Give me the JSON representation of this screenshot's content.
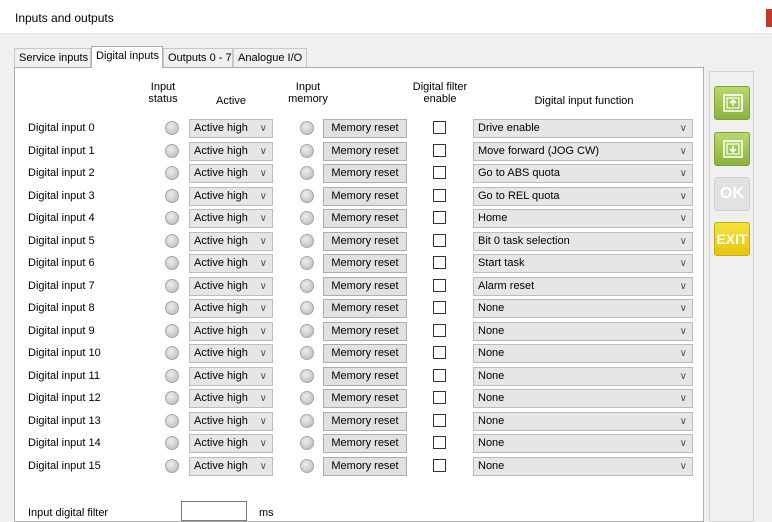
{
  "window": {
    "title": "Inputs and outputs"
  },
  "tabs": [
    {
      "label": "Service inputs",
      "active": false
    },
    {
      "label": "Digital inputs",
      "active": true
    },
    {
      "label": "Outputs 0 - 7",
      "active": false
    },
    {
      "label": "Analogue I/O",
      "active": false
    }
  ],
  "headers": {
    "input_status": "Input\nstatus",
    "active": "Active",
    "input_memory": "Input\nmemory",
    "digital_filter_enable": "Digital filter\nenable",
    "digital_input_function": "Digital input function"
  },
  "rows": [
    {
      "label": "Digital input 0",
      "active": "Active high",
      "memory_reset": "Memory reset",
      "filter_enabled": false,
      "function": "Drive enable"
    },
    {
      "label": "Digital input 1",
      "active": "Active high",
      "memory_reset": "Memory reset",
      "filter_enabled": false,
      "function": "Move forward (JOG CW)"
    },
    {
      "label": "Digital input 2",
      "active": "Active high",
      "memory_reset": "Memory reset",
      "filter_enabled": false,
      "function": "Go to ABS quota"
    },
    {
      "label": "Digital input 3",
      "active": "Active high",
      "memory_reset": "Memory reset",
      "filter_enabled": false,
      "function": "Go to REL quota"
    },
    {
      "label": "Digital input 4",
      "active": "Active high",
      "memory_reset": "Memory reset",
      "filter_enabled": false,
      "function": "Home"
    },
    {
      "label": "Digital input 5",
      "active": "Active high",
      "memory_reset": "Memory reset",
      "filter_enabled": false,
      "function": "Bit 0 task selection"
    },
    {
      "label": "Digital input 6",
      "active": "Active high",
      "memory_reset": "Memory reset",
      "filter_enabled": false,
      "function": "Start task"
    },
    {
      "label": "Digital input 7",
      "active": "Active high",
      "memory_reset": "Memory reset",
      "filter_enabled": false,
      "function": "Alarm reset"
    },
    {
      "label": "Digital input 8",
      "active": "Active high",
      "memory_reset": "Memory reset",
      "filter_enabled": false,
      "function": "None"
    },
    {
      "label": "Digital input 9",
      "active": "Active high",
      "memory_reset": "Memory reset",
      "filter_enabled": false,
      "function": "None"
    },
    {
      "label": "Digital input 10",
      "active": "Active high",
      "memory_reset": "Memory reset",
      "filter_enabled": false,
      "function": "None"
    },
    {
      "label": "Digital input 11",
      "active": "Active high",
      "memory_reset": "Memory reset",
      "filter_enabled": false,
      "function": "None"
    },
    {
      "label": "Digital input 12",
      "active": "Active high",
      "memory_reset": "Memory reset",
      "filter_enabled": false,
      "function": "None"
    },
    {
      "label": "Digital input 13",
      "active": "Active high",
      "memory_reset": "Memory reset",
      "filter_enabled": false,
      "function": "None"
    },
    {
      "label": "Digital input 14",
      "active": "Active high",
      "memory_reset": "Memory reset",
      "filter_enabled": false,
      "function": "None"
    },
    {
      "label": "Digital input 15",
      "active": "Active high",
      "memory_reset": "Memory reset",
      "filter_enabled": false,
      "function": "None"
    }
  ],
  "filter": {
    "label": "Input digital filter",
    "value": "",
    "unit": "ms"
  },
  "side_buttons": [
    {
      "name": "upload-button",
      "icon": "upload-to-device-icon",
      "color": "#9bc34a"
    },
    {
      "name": "download-button",
      "icon": "download-from-device-icon",
      "color": "#9bc34a"
    },
    {
      "name": "ok-button",
      "label": "OK",
      "enabled": false
    },
    {
      "name": "exit-button",
      "label": "EXIT",
      "color": "#f0d422"
    }
  ],
  "colors": {
    "accent_red": "#c0392b"
  }
}
